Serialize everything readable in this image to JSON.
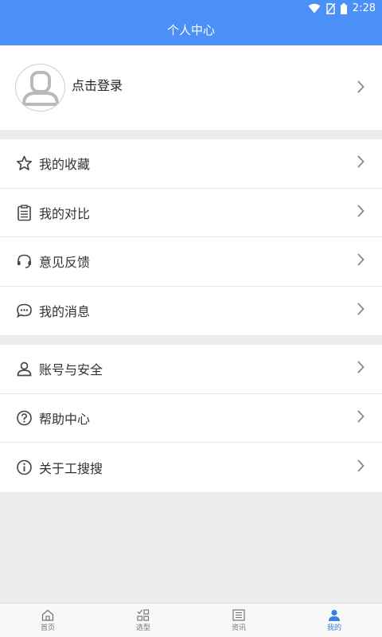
{
  "status": {
    "time": "2:28"
  },
  "header": {
    "title": "个人中心"
  },
  "profile": {
    "login_label": "点击登录"
  },
  "menu_group_1": [
    {
      "label": "我的收藏",
      "icon": "star-icon"
    },
    {
      "label": "我的对比",
      "icon": "clipboard-list-icon"
    },
    {
      "label": "意见反馈",
      "icon": "headset-icon"
    },
    {
      "label": "我的消息",
      "icon": "chat-bubble-icon"
    }
  ],
  "menu_group_2": [
    {
      "label": "账号与安全",
      "icon": "user-icon"
    },
    {
      "label": "帮助中心",
      "icon": "question-circle-icon"
    },
    {
      "label": "关于工搜搜",
      "icon": "info-circle-icon"
    }
  ],
  "tabs": [
    {
      "label": "首页",
      "icon": "home-icon"
    },
    {
      "label": "选型",
      "icon": "selection-grid-icon"
    },
    {
      "label": "资讯",
      "icon": "news-icon"
    },
    {
      "label": "我的",
      "icon": "profile-icon"
    }
  ],
  "colors": {
    "primary": "#4a90f7",
    "active_tab": "#3a7fe6"
  }
}
